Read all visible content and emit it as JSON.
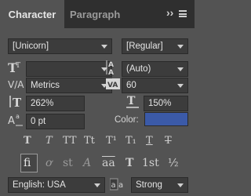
{
  "tabs": {
    "active": "Character",
    "inactive": "Paragraph",
    "menu_chevrons": "››"
  },
  "font": {
    "family": "[Unicorn]",
    "style": "[Regular]"
  },
  "size": {
    "value": "",
    "leading": "(Auto)"
  },
  "kerning": {
    "value": "Metrics",
    "tracking": "60"
  },
  "scale": {
    "vertical": "262%",
    "horizontal": "150%"
  },
  "baseline": {
    "value": "0 pt"
  },
  "color": {
    "label": "Color:",
    "swatch": "#3b5aa8"
  },
  "style_buttons": [
    "T",
    "T",
    "TT",
    "Tt",
    "T¹",
    "T₁",
    "T",
    "T"
  ],
  "glyph_buttons": [
    "fi",
    "ơ",
    "st",
    "A",
    "aa",
    "T",
    "1st",
    "½"
  ],
  "language": {
    "value": "English: USA",
    "aa_label": "a",
    "antialias": "Strong"
  }
}
